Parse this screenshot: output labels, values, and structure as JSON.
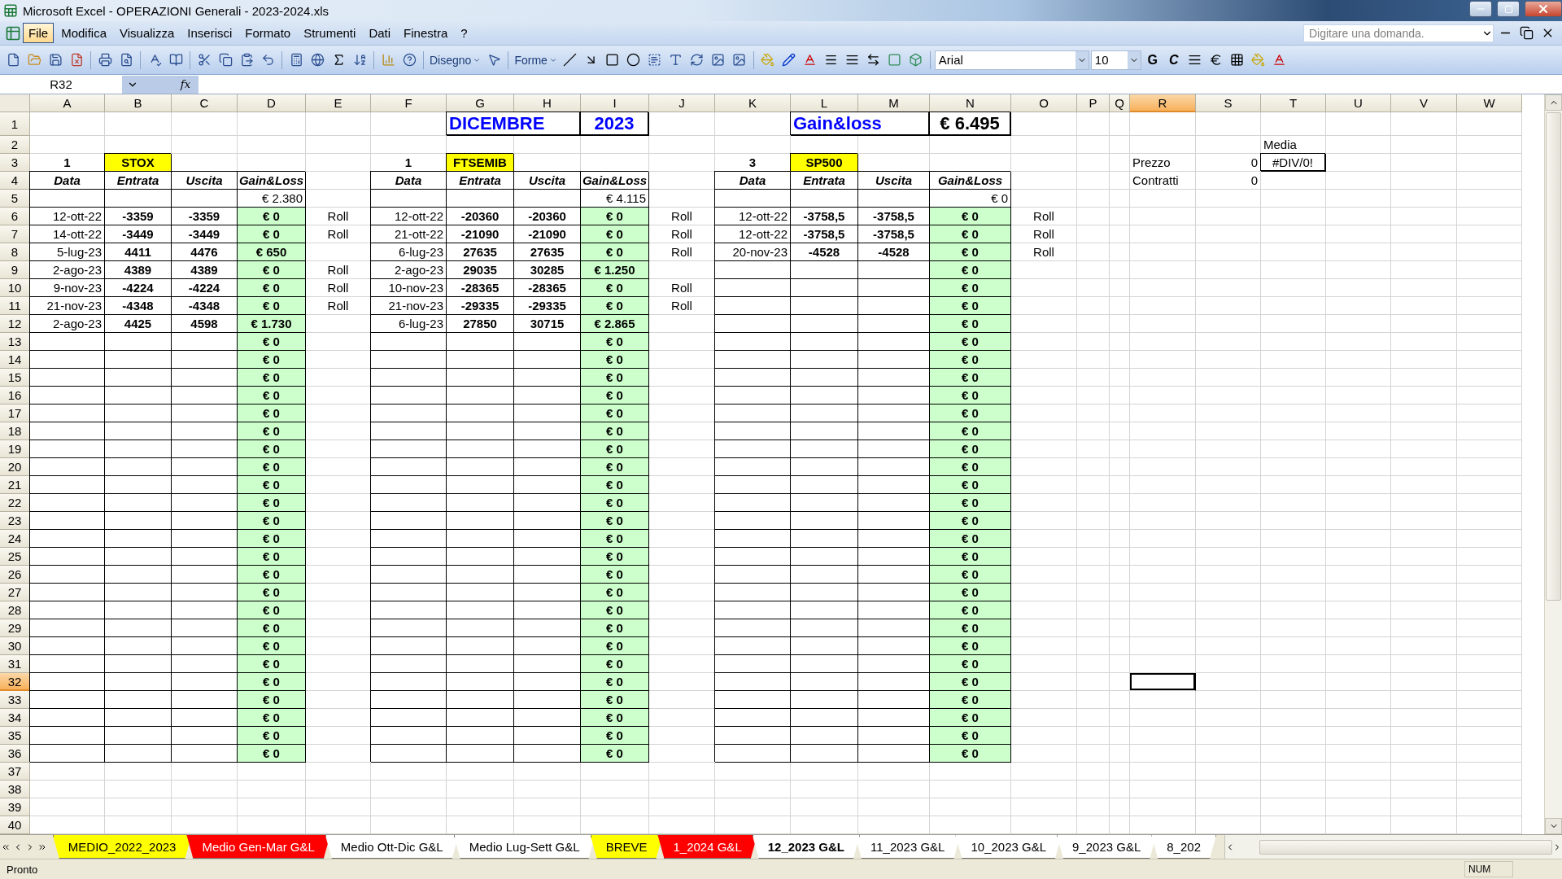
{
  "window": {
    "title": "Microsoft Excel - OPERAZIONI Generali - 2023-2024.xls"
  },
  "menu": [
    {
      "label": "File",
      "selected": true
    },
    {
      "label": "Modifica",
      "selected": false
    },
    {
      "label": "Visualizza",
      "selected": false
    },
    {
      "label": "Inserisci",
      "selected": false
    },
    {
      "label": "Formato",
      "selected": false
    },
    {
      "label": "Strumenti",
      "selected": false
    },
    {
      "label": "Dati",
      "selected": false
    },
    {
      "label": "Finestra",
      "selected": false
    },
    {
      "label": "?",
      "selected": false
    }
  ],
  "help": {
    "placeholder": "Digitare una domanda."
  },
  "drawing_toolbar": {
    "draw_menu": "Disegno",
    "shapes_menu": "Forme"
  },
  "format_toolbar": {
    "font": "Arial",
    "size": "10",
    "bold": "G",
    "italic": "C"
  },
  "formula_bar": {
    "name_box": "R32",
    "fx": "fx"
  },
  "sheet": {
    "columns": [
      {
        "label": "A",
        "selected": false
      },
      {
        "label": "B",
        "selected": false
      },
      {
        "label": "C",
        "selected": false
      },
      {
        "label": "D",
        "selected": false
      },
      {
        "label": "E",
        "selected": false
      },
      {
        "label": "F",
        "selected": false
      },
      {
        "label": "G",
        "selected": false
      },
      {
        "label": "H",
        "selected": false
      },
      {
        "label": "I",
        "selected": false
      },
      {
        "label": "J",
        "selected": false
      },
      {
        "label": "K",
        "selected": false
      },
      {
        "label": "L",
        "selected": false
      },
      {
        "label": "M",
        "selected": false
      },
      {
        "label": "N",
        "selected": false
      },
      {
        "label": "O",
        "selected": false
      },
      {
        "label": "P",
        "selected": false
      },
      {
        "label": "Q",
        "selected": false
      },
      {
        "label": "R",
        "selected": true
      },
      {
        "label": "S",
        "selected": false
      },
      {
        "label": "T",
        "selected": false
      },
      {
        "label": "U",
        "selected": false
      },
      {
        "label": "V",
        "selected": false
      },
      {
        "label": "W",
        "selected": false
      }
    ],
    "rows": [
      {
        "label": "1",
        "selected": false,
        "cells": [
          null,
          null,
          null,
          null,
          null,
          null,
          {
            "text": "DICEMBRE",
            "kind": "title"
          },
          null,
          {
            "text": "2023",
            "kind": "year"
          },
          null,
          null,
          {
            "text": "Gain&loss",
            "kind": "title"
          },
          null,
          {
            "text": "€ 6.495",
            "kind": "total"
          }
        ]
      },
      {
        "label": "2",
        "selected": false,
        "cells": [
          null,
          null,
          null,
          null,
          null,
          null,
          null,
          null,
          null,
          null,
          null,
          null,
          null,
          null,
          null,
          null,
          null,
          null,
          null,
          {
            "text": "Media",
            "kind": "plain"
          }
        ]
      },
      {
        "label": "3",
        "selected": false,
        "cells": [
          {
            "text": "1",
            "kind": "strong"
          },
          {
            "text": "STOX",
            "kind": "tag"
          },
          null,
          null,
          null,
          {
            "text": "1",
            "kind": "strong"
          },
          {
            "text": "FTSEMIB",
            "kind": "tag"
          },
          null,
          null,
          null,
          {
            "text": "3",
            "kind": "strong"
          },
          {
            "text": "SP500",
            "kind": "tag"
          },
          null,
          null,
          null,
          null,
          null,
          {
            "text": "Prezzo",
            "kind": "plain"
          },
          {
            "text": "0",
            "kind": "number"
          },
          {
            "text": "#DIV/0!",
            "kind": "error"
          }
        ]
      },
      {
        "label": "4",
        "selected": false,
        "cells": [
          {
            "text": "Data",
            "kind": "head"
          },
          {
            "text": "Entrata",
            "kind": "head"
          },
          {
            "text": "Uscita",
            "kind": "head"
          },
          {
            "text": "Gain&Loss",
            "kind": "head"
          },
          null,
          {
            "text": "Data",
            "kind": "head"
          },
          {
            "text": "Entrata",
            "kind": "head"
          },
          {
            "text": "Uscita",
            "kind": "head"
          },
          {
            "text": "Gain&Loss",
            "kind": "head"
          },
          null,
          {
            "text": "Data",
            "kind": "head"
          },
          {
            "text": "Entrata",
            "kind": "head"
          },
          {
            "text": "Uscita",
            "kind": "head"
          },
          {
            "text": "Gain&Loss",
            "kind": "head"
          },
          null,
          null,
          null,
          {
            "text": "Contratti",
            "kind": "plain"
          },
          {
            "text": "0",
            "kind": "number"
          }
        ]
      },
      {
        "label": "5",
        "selected": false,
        "cells": [
          null,
          null,
          null,
          {
            "text": "€ 2.380",
            "kind": "number"
          },
          null,
          null,
          null,
          null,
          {
            "text": "€ 4.115",
            "kind": "number"
          },
          null,
          null,
          null,
          null,
          {
            "text": "€ 0",
            "kind": "number"
          }
        ]
      },
      {
        "label": "6",
        "selected": false,
        "cells": [
          {
            "text": "12-ott-22",
            "kind": "number"
          },
          {
            "text": "-3359",
            "kind": "strong"
          },
          {
            "text": "-3359",
            "kind": "strong"
          },
          {
            "text": "€ 0",
            "kind": "gain"
          },
          {
            "text": "Roll",
            "kind": "center"
          },
          {
            "text": "12-ott-22",
            "kind": "number"
          },
          {
            "text": "-20360",
            "kind": "strong"
          },
          {
            "text": "-20360",
            "kind": "strong"
          },
          {
            "text": "€ 0",
            "kind": "gain"
          },
          {
            "text": "Roll",
            "kind": "center"
          },
          {
            "text": "12-ott-22",
            "kind": "number"
          },
          {
            "text": "-3758,5",
            "kind": "strong"
          },
          {
            "text": "-3758,5",
            "kind": "strong"
          },
          {
            "text": "€ 0",
            "kind": "gain"
          },
          {
            "text": "Roll",
            "kind": "center"
          }
        ]
      },
      {
        "label": "7",
        "selected": false,
        "cells": [
          {
            "text": "14-ott-22",
            "kind": "number"
          },
          {
            "text": "-3449",
            "kind": "strong"
          },
          {
            "text": "-3449",
            "kind": "strong"
          },
          {
            "text": "€ 0",
            "kind": "gain"
          },
          {
            "text": "Roll",
            "kind": "center"
          },
          {
            "text": "21-ott-22",
            "kind": "number"
          },
          {
            "text": "-21090",
            "kind": "strong"
          },
          {
            "text": "-21090",
            "kind": "strong"
          },
          {
            "text": "€ 0",
            "kind": "gain"
          },
          {
            "text": "Roll",
            "kind": "center"
          },
          {
            "text": "12-ott-22",
            "kind": "number"
          },
          {
            "text": "-3758,5",
            "kind": "strong"
          },
          {
            "text": "-3758,5",
            "kind": "strong"
          },
          {
            "text": "€ 0",
            "kind": "gain"
          },
          {
            "text": "Roll",
            "kind": "center"
          }
        ]
      },
      {
        "label": "8",
        "selected": false,
        "cells": [
          {
            "text": "5-lug-23",
            "kind": "number"
          },
          {
            "text": "4411",
            "kind": "strong"
          },
          {
            "text": "4476",
            "kind": "strong"
          },
          {
            "text": "€ 650",
            "kind": "gain"
          },
          null,
          {
            "text": "6-lug-23",
            "kind": "number"
          },
          {
            "text": "27635",
            "kind": "strong"
          },
          {
            "text": "27635",
            "kind": "strong"
          },
          {
            "text": "€ 0",
            "kind": "gain"
          },
          {
            "text": "Roll",
            "kind": "center"
          },
          {
            "text": "20-nov-23",
            "kind": "number"
          },
          {
            "text": "-4528",
            "kind": "strong"
          },
          {
            "text": "-4528",
            "kind": "strong"
          },
          {
            "text": "€ 0",
            "kind": "gain"
          },
          {
            "text": "Roll",
            "kind": "center"
          }
        ]
      },
      {
        "label": "9",
        "selected": false,
        "cells": [
          {
            "text": "2-ago-23",
            "kind": "number"
          },
          {
            "text": "4389",
            "kind": "strong"
          },
          {
            "text": "4389",
            "kind": "strong"
          },
          {
            "text": "€ 0",
            "kind": "gain"
          },
          {
            "text": "Roll",
            "kind": "center"
          },
          {
            "text": "2-ago-23",
            "kind": "number"
          },
          {
            "text": "29035",
            "kind": "strong"
          },
          {
            "text": "30285",
            "kind": "strong"
          },
          {
            "text": "€ 1.250",
            "kind": "gain"
          },
          null,
          null,
          null,
          null,
          {
            "text": "€ 0",
            "kind": "gain"
          }
        ]
      },
      {
        "label": "10",
        "selected": false,
        "cells": [
          {
            "text": "9-nov-23",
            "kind": "number"
          },
          {
            "text": "-4224",
            "kind": "strong"
          },
          {
            "text": "-4224",
            "kind": "strong"
          },
          {
            "text": "€ 0",
            "kind": "gain"
          },
          {
            "text": "Roll",
            "kind": "center"
          },
          {
            "text": "10-nov-23",
            "kind": "number"
          },
          {
            "text": "-28365",
            "kind": "strong"
          },
          {
            "text": "-28365",
            "kind": "strong"
          },
          {
            "text": "€ 0",
            "kind": "gain"
          },
          {
            "text": "Roll",
            "kind": "center"
          },
          null,
          null,
          null,
          {
            "text": "€ 0",
            "kind": "gain"
          }
        ]
      },
      {
        "label": "11",
        "selected": false,
        "cells": [
          {
            "text": "21-nov-23",
            "kind": "number"
          },
          {
            "text": "-4348",
            "kind": "strong"
          },
          {
            "text": "-4348",
            "kind": "strong"
          },
          {
            "text": "€ 0",
            "kind": "gain"
          },
          {
            "text": "Roll",
            "kind": "center"
          },
          {
            "text": "21-nov-23",
            "kind": "number"
          },
          {
            "text": "-29335",
            "kind": "strong"
          },
          {
            "text": "-29335",
            "kind": "strong"
          },
          {
            "text": "€ 0",
            "kind": "gain"
          },
          {
            "text": "Roll",
            "kind": "center"
          },
          null,
          null,
          null,
          {
            "text": "€ 0",
            "kind": "gain"
          }
        ]
      },
      {
        "label": "12",
        "selected": false,
        "cells": [
          {
            "text": "2-ago-23",
            "kind": "number"
          },
          {
            "text": "4425",
            "kind": "strong"
          },
          {
            "text": "4598",
            "kind": "strong"
          },
          {
            "text": "€ 1.730",
            "kind": "gain"
          },
          null,
          {
            "text": "6-lug-23",
            "kind": "number"
          },
          {
            "text": "27850",
            "kind": "strong"
          },
          {
            "text": "30715",
            "kind": "strong"
          },
          {
            "text": "€ 2.865",
            "kind": "gain"
          },
          null,
          null,
          null,
          null,
          {
            "text": "€ 0",
            "kind": "gain"
          }
        ]
      },
      {
        "label": "13",
        "selected": false,
        "cells": [
          null,
          null,
          null,
          {
            "text": "€ 0",
            "kind": "gain"
          },
          null,
          null,
          null,
          null,
          {
            "text": "€ 0",
            "kind": "gain"
          },
          null,
          null,
          null,
          null,
          {
            "text": "€ 0",
            "kind": "gain"
          }
        ]
      },
      {
        "label": "14",
        "selected": false,
        "cells": [
          null,
          null,
          null,
          {
            "text": "€ 0",
            "kind": "gain"
          },
          null,
          null,
          null,
          null,
          {
            "text": "€ 0",
            "kind": "gain"
          },
          null,
          null,
          null,
          null,
          {
            "text": "€ 0",
            "kind": "gain"
          }
        ]
      },
      {
        "label": "15",
        "selected": false,
        "cells": [
          null,
          null,
          null,
          {
            "text": "€ 0",
            "kind": "gain"
          },
          null,
          null,
          null,
          null,
          {
            "text": "€ 0",
            "kind": "gain"
          },
          null,
          null,
          null,
          null,
          {
            "text": "€ 0",
            "kind": "gain"
          }
        ]
      },
      {
        "label": "16",
        "selected": false,
        "cells": [
          null,
          null,
          null,
          {
            "text": "€ 0",
            "kind": "gain"
          },
          null,
          null,
          null,
          null,
          {
            "text": "€ 0",
            "kind": "gain"
          },
          null,
          null,
          null,
          null,
          {
            "text": "€ 0",
            "kind": "gain"
          }
        ]
      },
      {
        "label": "17",
        "selected": false,
        "cells": [
          null,
          null,
          null,
          {
            "text": "€ 0",
            "kind": "gain"
          },
          null,
          null,
          null,
          null,
          {
            "text": "€ 0",
            "kind": "gain"
          },
          null,
          null,
          null,
          null,
          {
            "text": "€ 0",
            "kind": "gain"
          }
        ]
      },
      {
        "label": "18",
        "selected": false,
        "cells": [
          null,
          null,
          null,
          {
            "text": "€ 0",
            "kind": "gain"
          },
          null,
          null,
          null,
          null,
          {
            "text": "€ 0",
            "kind": "gain"
          },
          null,
          null,
          null,
          null,
          {
            "text": "€ 0",
            "kind": "gain"
          }
        ]
      },
      {
        "label": "19",
        "selected": false,
        "cells": [
          null,
          null,
          null,
          {
            "text": "€ 0",
            "kind": "gain"
          },
          null,
          null,
          null,
          null,
          {
            "text": "€ 0",
            "kind": "gain"
          },
          null,
          null,
          null,
          null,
          {
            "text": "€ 0",
            "kind": "gain"
          }
        ]
      },
      {
        "label": "20",
        "selected": false,
        "cells": [
          null,
          null,
          null,
          {
            "text": "€ 0",
            "kind": "gain"
          },
          null,
          null,
          null,
          null,
          {
            "text": "€ 0",
            "kind": "gain"
          },
          null,
          null,
          null,
          null,
          {
            "text": "€ 0",
            "kind": "gain"
          }
        ]
      },
      {
        "label": "21",
        "selected": false,
        "cells": [
          null,
          null,
          null,
          {
            "text": "€ 0",
            "kind": "gain"
          },
          null,
          null,
          null,
          null,
          {
            "text": "€ 0",
            "kind": "gain"
          },
          null,
          null,
          null,
          null,
          {
            "text": "€ 0",
            "kind": "gain"
          }
        ]
      },
      {
        "label": "22",
        "selected": false,
        "cells": [
          null,
          null,
          null,
          {
            "text": "€ 0",
            "kind": "gain"
          },
          null,
          null,
          null,
          null,
          {
            "text": "€ 0",
            "kind": "gain"
          },
          null,
          null,
          null,
          null,
          {
            "text": "€ 0",
            "kind": "gain"
          }
        ]
      },
      {
        "label": "23",
        "selected": false,
        "cells": [
          null,
          null,
          null,
          {
            "text": "€ 0",
            "kind": "gain"
          },
          null,
          null,
          null,
          null,
          {
            "text": "€ 0",
            "kind": "gain"
          },
          null,
          null,
          null,
          null,
          {
            "text": "€ 0",
            "kind": "gain"
          }
        ]
      },
      {
        "label": "24",
        "selected": false,
        "cells": [
          null,
          null,
          null,
          {
            "text": "€ 0",
            "kind": "gain"
          },
          null,
          null,
          null,
          null,
          {
            "text": "€ 0",
            "kind": "gain"
          },
          null,
          null,
          null,
          null,
          {
            "text": "€ 0",
            "kind": "gain"
          }
        ]
      },
      {
        "label": "25",
        "selected": false,
        "cells": [
          null,
          null,
          null,
          {
            "text": "€ 0",
            "kind": "gain"
          },
          null,
          null,
          null,
          null,
          {
            "text": "€ 0",
            "kind": "gain"
          },
          null,
          null,
          null,
          null,
          {
            "text": "€ 0",
            "kind": "gain"
          }
        ]
      },
      {
        "label": "26",
        "selected": false,
        "cells": [
          null,
          null,
          null,
          {
            "text": "€ 0",
            "kind": "gain"
          },
          null,
          null,
          null,
          null,
          {
            "text": "€ 0",
            "kind": "gain"
          },
          null,
          null,
          null,
          null,
          {
            "text": "€ 0",
            "kind": "gain"
          }
        ]
      },
      {
        "label": "27",
        "selected": false,
        "cells": [
          null,
          null,
          null,
          {
            "text": "€ 0",
            "kind": "gain"
          },
          null,
          null,
          null,
          null,
          {
            "text": "€ 0",
            "kind": "gain"
          },
          null,
          null,
          null,
          null,
          {
            "text": "€ 0",
            "kind": "gain"
          }
        ]
      },
      {
        "label": "28",
        "selected": false,
        "cells": [
          null,
          null,
          null,
          {
            "text": "€ 0",
            "kind": "gain"
          },
          null,
          null,
          null,
          null,
          {
            "text": "€ 0",
            "kind": "gain"
          },
          null,
          null,
          null,
          null,
          {
            "text": "€ 0",
            "kind": "gain"
          }
        ]
      },
      {
        "label": "29",
        "selected": false,
        "cells": [
          null,
          null,
          null,
          {
            "text": "€ 0",
            "kind": "gain"
          },
          null,
          null,
          null,
          null,
          {
            "text": "€ 0",
            "kind": "gain"
          },
          null,
          null,
          null,
          null,
          {
            "text": "€ 0",
            "kind": "gain"
          }
        ]
      },
      {
        "label": "30",
        "selected": false,
        "cells": [
          null,
          null,
          null,
          {
            "text": "€ 0",
            "kind": "gain"
          },
          null,
          null,
          null,
          null,
          {
            "text": "€ 0",
            "kind": "gain"
          },
          null,
          null,
          null,
          null,
          {
            "text": "€ 0",
            "kind": "gain"
          }
        ]
      },
      {
        "label": "31",
        "selected": false,
        "cells": [
          null,
          null,
          null,
          {
            "text": "€ 0",
            "kind": "gain"
          },
          null,
          null,
          null,
          null,
          {
            "text": "€ 0",
            "kind": "gain"
          },
          null,
          null,
          null,
          null,
          {
            "text": "€ 0",
            "kind": "gain"
          }
        ]
      },
      {
        "label": "32",
        "selected": true,
        "cells": [
          null,
          null,
          null,
          {
            "text": "€ 0",
            "kind": "gain"
          },
          null,
          null,
          null,
          null,
          {
            "text": "€ 0",
            "kind": "gain"
          },
          null,
          null,
          null,
          null,
          {
            "text": "€ 0",
            "kind": "gain"
          }
        ]
      },
      {
        "label": "33",
        "selected": false,
        "cells": [
          null,
          null,
          null,
          {
            "text": "€ 0",
            "kind": "gain"
          },
          null,
          null,
          null,
          null,
          {
            "text": "€ 0",
            "kind": "gain"
          },
          null,
          null,
          null,
          null,
          {
            "text": "€ 0",
            "kind": "gain"
          }
        ]
      },
      {
        "label": "34",
        "selected": false,
        "cells": [
          null,
          null,
          null,
          {
            "text": "€ 0",
            "kind": "gain"
          },
          null,
          null,
          null,
          null,
          {
            "text": "€ 0",
            "kind": "gain"
          },
          null,
          null,
          null,
          null,
          {
            "text": "€ 0",
            "kind": "gain"
          }
        ]
      },
      {
        "label": "35",
        "selected": false,
        "cells": [
          null,
          null,
          null,
          {
            "text": "€ 0",
            "kind": "gain"
          },
          null,
          null,
          null,
          null,
          {
            "text": "€ 0",
            "kind": "gain"
          },
          null,
          null,
          null,
          null,
          {
            "text": "€ 0",
            "kind": "gain"
          }
        ]
      },
      {
        "label": "36",
        "selected": false,
        "cells": [
          null,
          null,
          null,
          {
            "text": "€ 0",
            "kind": "gain"
          },
          null,
          null,
          null,
          null,
          {
            "text": "€ 0",
            "kind": "gain"
          },
          null,
          null,
          null,
          null,
          {
            "text": "€ 0",
            "kind": "gain"
          }
        ]
      },
      {
        "label": "37",
        "selected": false,
        "cells": []
      },
      {
        "label": "38",
        "selected": false,
        "cells": []
      },
      {
        "label": "39",
        "selected": false,
        "cells": []
      },
      {
        "label": "40",
        "selected": false,
        "cells": []
      }
    ]
  },
  "sheet_tabs": [
    {
      "label": "MEDIO_2022_2023",
      "color": "#ffff00",
      "selected": false
    },
    {
      "label": "Medio Gen-Mar G&L",
      "color": "#ff0000",
      "selected": false
    },
    {
      "label": "Medio Ott-Dic G&L",
      "color": "#ffffff",
      "selected": false
    },
    {
      "label": "Medio Lug-Sett G&L",
      "color": "#ffffff",
      "selected": false
    },
    {
      "label": "BREVE",
      "color": "#ffff00",
      "selected": false
    },
    {
      "label": "1_2024 G&L",
      "color": "#ff0000",
      "selected": false
    },
    {
      "label": "12_2023 G&L",
      "color": "#ffffff",
      "selected": true
    },
    {
      "label": "11_2023 G&L",
      "color": "#ffffff",
      "selected": false
    },
    {
      "label": "10_2023 G&L",
      "color": "#ffffff",
      "selected": false
    },
    {
      "label": "9_2023 G&L",
      "color": "#ffffff",
      "selected": false
    },
    {
      "label": "8_202",
      "color": "#ffffff",
      "selected": false
    }
  ],
  "status_bar": {
    "message": "Pronto",
    "indicator": "NUM"
  }
}
